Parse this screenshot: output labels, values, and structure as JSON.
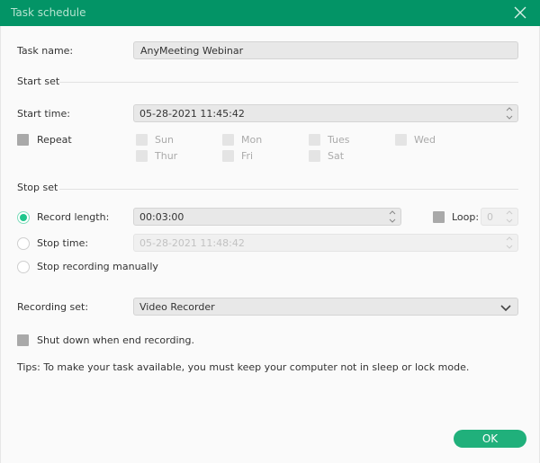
{
  "window": {
    "title": "Task schedule",
    "close_icon": "close-x-icon"
  },
  "task": {
    "label": "Task name:",
    "value": "AnyMeeting Webinar"
  },
  "start_set": {
    "heading": "Start set",
    "start_time_label": "Start time:",
    "start_time_value": "05-28-2021 11:45:42",
    "repeat_label": "Repeat",
    "repeat_checked": false,
    "days": [
      {
        "label": "Sun",
        "checked": false
      },
      {
        "label": "Mon",
        "checked": false
      },
      {
        "label": "Tues",
        "checked": false
      },
      {
        "label": "Wed",
        "checked": false
      },
      {
        "label": "Thur",
        "checked": false
      },
      {
        "label": "Fri",
        "checked": false
      },
      {
        "label": "Sat",
        "checked": false
      }
    ]
  },
  "stop_set": {
    "heading": "Stop set",
    "record_length_label": "Record length:",
    "record_length_value": "00:03:00",
    "record_length_selected": true,
    "loop_label": "Loop:",
    "loop_value": "0",
    "loop_checked": false,
    "stop_time_label": "Stop time:",
    "stop_time_value": "05-28-2021 11:48:42",
    "stop_time_selected": false,
    "stop_manual_label": "Stop recording manually",
    "stop_manual_selected": false
  },
  "recording_set": {
    "label": "Recording set:",
    "value": "Video Recorder"
  },
  "shutdown": {
    "label": "Shut down when end recording.",
    "checked": false
  },
  "tips": "Tips: To make your task available, you must keep your computer not in sleep or lock mode.",
  "buttons": {
    "ok": "OK"
  },
  "colors": {
    "accent": "#039466",
    "button": "#20b07b",
    "radio_on": "#1fc68c"
  }
}
